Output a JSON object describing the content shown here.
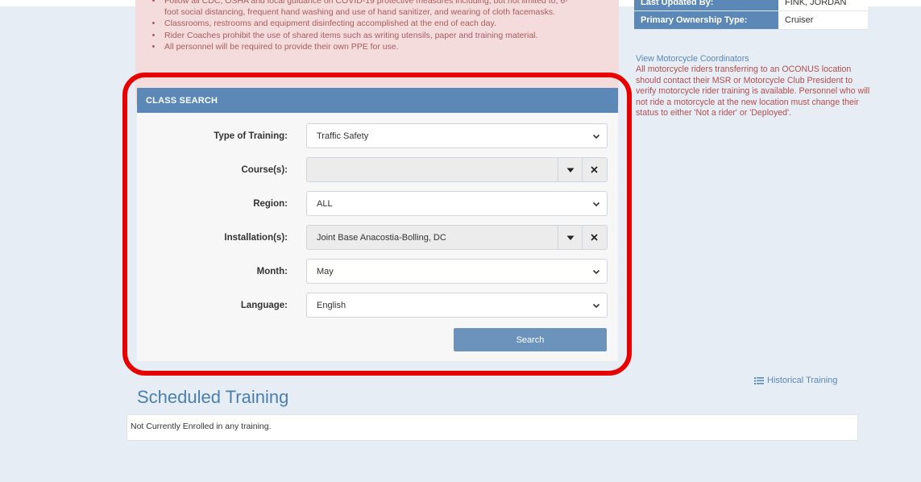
{
  "notice": {
    "lines": [
      "Follow all CDC, OSHA and local guidance on COVID-19 protective measures including, but not limited to, 6-",
      "foot social distancing, frequent hand washing and use of hand sanitizer, and wearing of cloth facemasks.",
      "Classrooms, restrooms and equipment disinfecting accomplished at the end of each day.",
      "Rider Coaches prohibit the use of shared items such as writing utensils, paper and training material.",
      "All personnel will be required to provide their own PPE for use."
    ]
  },
  "info": {
    "last_updated_by_label": "Last Updated By:",
    "last_updated_by_value": "FINK, JORDAN",
    "ownership_label": "Primary Ownership Type:",
    "ownership_value": "Cruiser"
  },
  "coordinators": {
    "link": "View Motorcycle Coordinators",
    "text": "All motorcycle riders transferring to an OCONUS location should contact their MSR or Motorcycle Club President to verify motorcycle rider training is available. Personnel who will not ride a motorcycle at the new location must change their status to either 'Not a rider' or 'Deployed'."
  },
  "class_search": {
    "header": "CLASS SEARCH",
    "type_label": "Type of Training:",
    "type_value": "Traffic Safety",
    "courses_label": "Course(s):",
    "courses_value": "",
    "region_label": "Region:",
    "region_value": "ALL",
    "installation_label": "Installation(s):",
    "installation_value": "Joint Base Anacostia-Bolling, DC",
    "month_label": "Month:",
    "month_value": "May",
    "language_label": "Language:",
    "language_value": "English",
    "search_label": "Search"
  },
  "historical": {
    "label": "Historical Training"
  },
  "scheduled": {
    "title": "Scheduled Training",
    "empty_text": "Not Currently Enrolled in any training."
  },
  "colors": {
    "accent": "#5b88b7",
    "highlight": "#e60000",
    "notice_bg": "#f4dcdc"
  }
}
